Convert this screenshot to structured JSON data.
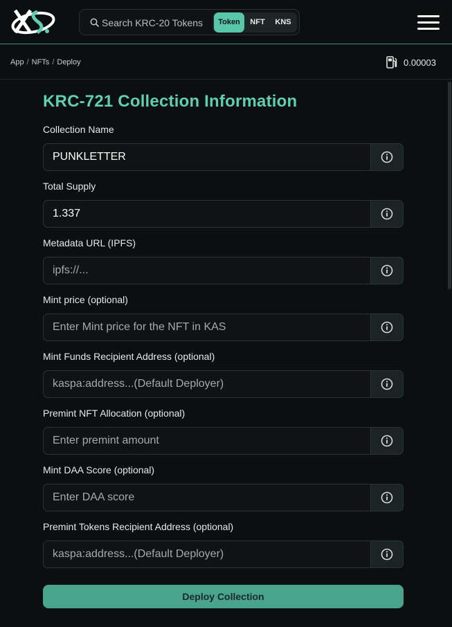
{
  "header": {
    "search_placeholder": "Search KRC-20 Tokens",
    "segments": [
      {
        "label": "Token",
        "active": true
      },
      {
        "label": "NFT",
        "active": false
      },
      {
        "label": "KNS",
        "active": false
      }
    ]
  },
  "breadcrumb": {
    "items": [
      "App",
      "NFTs",
      "Deploy"
    ],
    "separator": "/"
  },
  "gas": {
    "value": "0.00003"
  },
  "form": {
    "title": "KRC-721 Collection Information",
    "fields": [
      {
        "label": "Collection Name",
        "value": "PUNKLETTER",
        "placeholder": ""
      },
      {
        "label": "Total Supply",
        "value": "1.337",
        "placeholder": ""
      },
      {
        "label": "Metadata URL (IPFS)",
        "value": "",
        "placeholder": "ipfs://..."
      },
      {
        "label": "Mint price (optional)",
        "value": "",
        "placeholder": "Enter Mint price for the NFT in KAS"
      },
      {
        "label": "Mint Funds Recipient Address (optional)",
        "value": "",
        "placeholder": "kaspa:address...(Default Deployer)"
      },
      {
        "label": "Premint NFT Allocation (optional)",
        "value": "",
        "placeholder": "Enter premint amount"
      },
      {
        "label": "Mint DAA Score (optional)",
        "value": "",
        "placeholder": "Enter DAA score"
      },
      {
        "label": "Premint Tokens Recipient Address (optional)",
        "value": "",
        "placeholder": "kaspa:address...(Default Deployer)"
      }
    ],
    "submit_label": "Deploy Collection"
  },
  "colors": {
    "accent": "#5fcfb0",
    "button": "#4aa38d",
    "background": "#0c0f10"
  },
  "icons": [
    "logo-icon",
    "search-icon",
    "hamburger-icon",
    "gas-pump-icon",
    "info-icon"
  ]
}
